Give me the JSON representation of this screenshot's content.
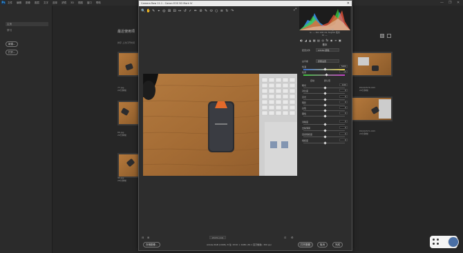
{
  "ps": {
    "logo": "Ps",
    "menu": [
      "文件",
      "编辑",
      "图像",
      "图层",
      "文字",
      "选择",
      "滤镜",
      "3D",
      "视图",
      "窗口",
      "帮助"
    ],
    "win_controls": [
      "—",
      "❐",
      "✕"
    ],
    "left": {
      "recent_items": [
        "主页",
        "学习"
      ],
      "new_button": "新建...",
      "open_button": "打开..."
    },
    "center": {
      "title": "最近使用项",
      "subtitle": "排序  上次打开时间",
      "thumbs": [
        {
          "label": "77.jpg",
          "sub": "29分钟前"
        },
        {
          "label": "66.jpg",
          "sub": "29分钟前"
        },
        {
          "label": "44.jpg",
          "sub": "28分钟前"
        },
        {
          "label": "DSC02576.CR3",
          "sub": "29分钟前"
        },
        {
          "label": "DSC02571.CR3",
          "sub": "29分钟前"
        }
      ]
    }
  },
  "cr": {
    "title": "Camera Raw 11.1  -  Canon EOS 5D Mark IV",
    "close": "✕",
    "tools": [
      "🔍",
      "✋",
      "✎",
      "⌖",
      "◎",
      "⊞",
      "⊟",
      "↔",
      "↺",
      "✓",
      "✏",
      "⊘",
      "✎",
      "⬭",
      "○",
      "≡",
      "↻",
      "↷"
    ],
    "zoom_value": "28.6% (12)",
    "info_line": "Adobe RGB (1998); 8 位; 6720 × 4480 (30.1 百万像素); 300 ppi",
    "buttons": {
      "save": "存储图像...",
      "open": "打开图像",
      "cancel": "取消",
      "done": "完成"
    },
    "histogram_readout": [
      "R: ---   f/4.0   1/60 秒",
      "G: ---   ISO 200   24-70@50 毫米",
      "B: ---"
    ],
    "panel": {
      "heading": "基本",
      "profile_label": "配置文件",
      "profile_value": "Adobe 颜色",
      "wb_label": "白平衡",
      "wb_value": "原照设置",
      "sliders": [
        {
          "label": "色温",
          "value": "5200"
        },
        {
          "label": "色调",
          "value": "+5"
        },
        {
          "label": "曝光",
          "value": "0.00"
        },
        {
          "label": "对比度",
          "value": "0"
        },
        {
          "label": "高光",
          "value": "0"
        },
        {
          "label": "阴影",
          "value": "0"
        },
        {
          "label": "白色",
          "value": "0"
        },
        {
          "label": "黑色",
          "value": "0"
        },
        {
          "label": "清晰度",
          "value": "0"
        },
        {
          "label": "去除薄雾",
          "value": "0"
        },
        {
          "label": "自然饱和度",
          "value": "0"
        },
        {
          "label": "饱和度",
          "value": "0"
        }
      ],
      "auto_label": "自动",
      "default_label": "默认值"
    }
  },
  "colors": {
    "wood": "#a86f37",
    "ssd_accent": "#e46a2a",
    "laptop": "#c9c9c9"
  }
}
